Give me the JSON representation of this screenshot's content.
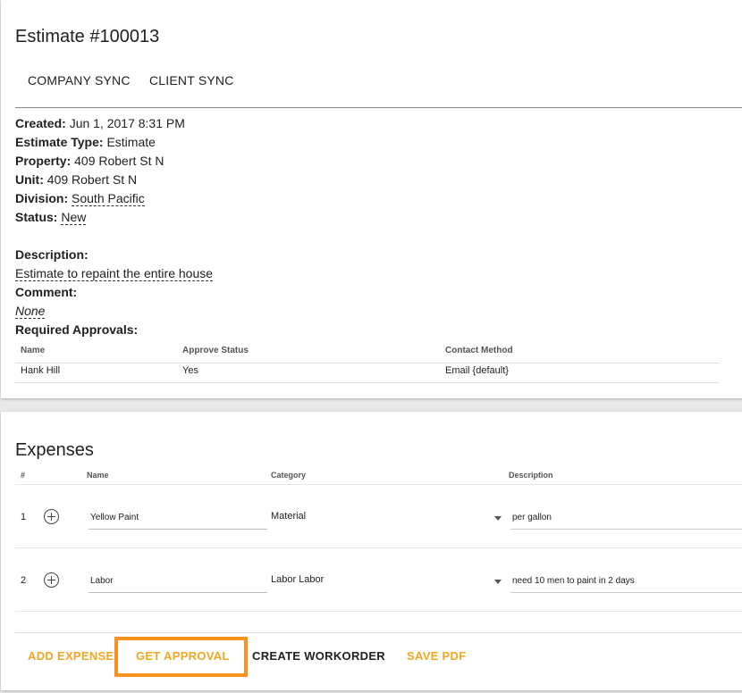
{
  "estimate": {
    "title": "Estimate #100013",
    "tabs": [
      "COMPANY SYNC",
      "CLIENT SYNC"
    ],
    "created_label": "Created:",
    "created_value": "Jun 1, 2017 8:31 PM",
    "type_label": "Estimate Type:",
    "type_value": "Estimate",
    "property_label": "Property:",
    "property_value": "409 Robert St N",
    "unit_label": "Unit:",
    "unit_value": "409 Robert St N",
    "division_label": "Division:",
    "division_value": "South Pacific",
    "status_label": "Status:",
    "status_value": "New",
    "description_label": "Description:",
    "description_value": "Estimate to repaint the entire house",
    "comment_label": "Comment:",
    "comment_value": "None",
    "approvals_label": "Required Approvals:",
    "approvals_headers": [
      "Name",
      "Approve Status",
      "Contact Method"
    ],
    "approvals_rows": [
      [
        "Hank Hill",
        "Yes",
        "Email {default}"
      ]
    ]
  },
  "expenses": {
    "title": "Expenses",
    "headers": [
      "#",
      "Name",
      "Category",
      "Description"
    ],
    "rows": [
      {
        "num": "1",
        "name": "Yellow Paint",
        "category": "Material",
        "description": "per gallon"
      },
      {
        "num": "2",
        "name": "Labor",
        "category": "Labor Labor",
        "description": "need 10 men to paint in 2 days"
      }
    ],
    "buttons": {
      "add": "ADD EXPENSE",
      "approval": "GET APPROVAL",
      "workorder": "CREATE WORKORDER",
      "pdf": "SAVE PDF"
    }
  },
  "colors": {
    "accent": "#f5a623",
    "highlight": "#f7931e"
  }
}
